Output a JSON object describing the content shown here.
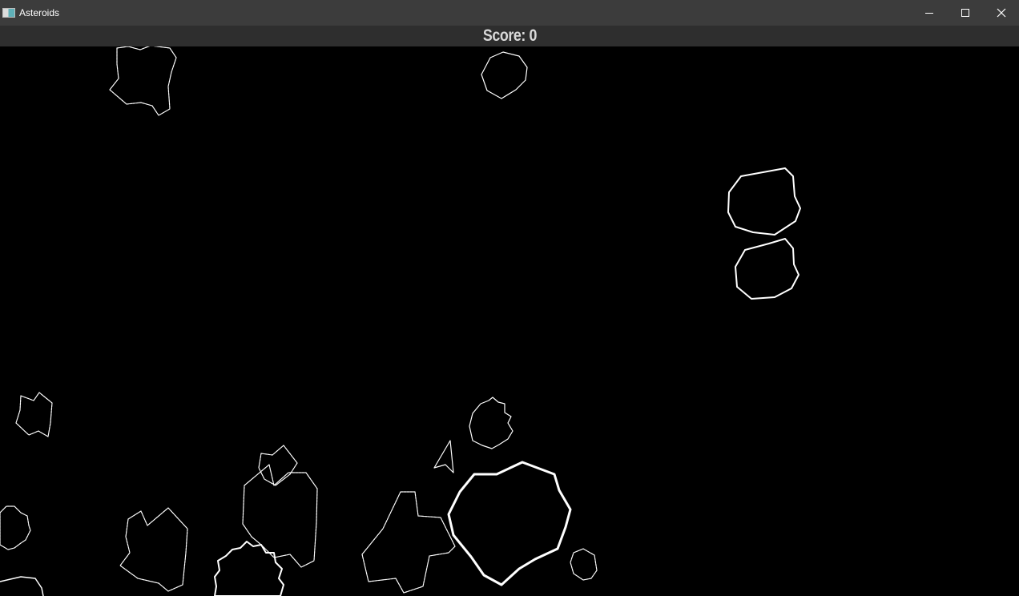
{
  "window": {
    "title": "Asteroids",
    "icon": "app-icon",
    "controls": [
      "minimize-icon",
      "maximize-icon",
      "close-icon"
    ]
  },
  "hud": {
    "score_text": "Score: 0"
  },
  "colors": {
    "titlebar": "#3c3c3c",
    "scorebar": "#2e2e2e",
    "background": "#000000",
    "outline": "#ffffff"
  }
}
